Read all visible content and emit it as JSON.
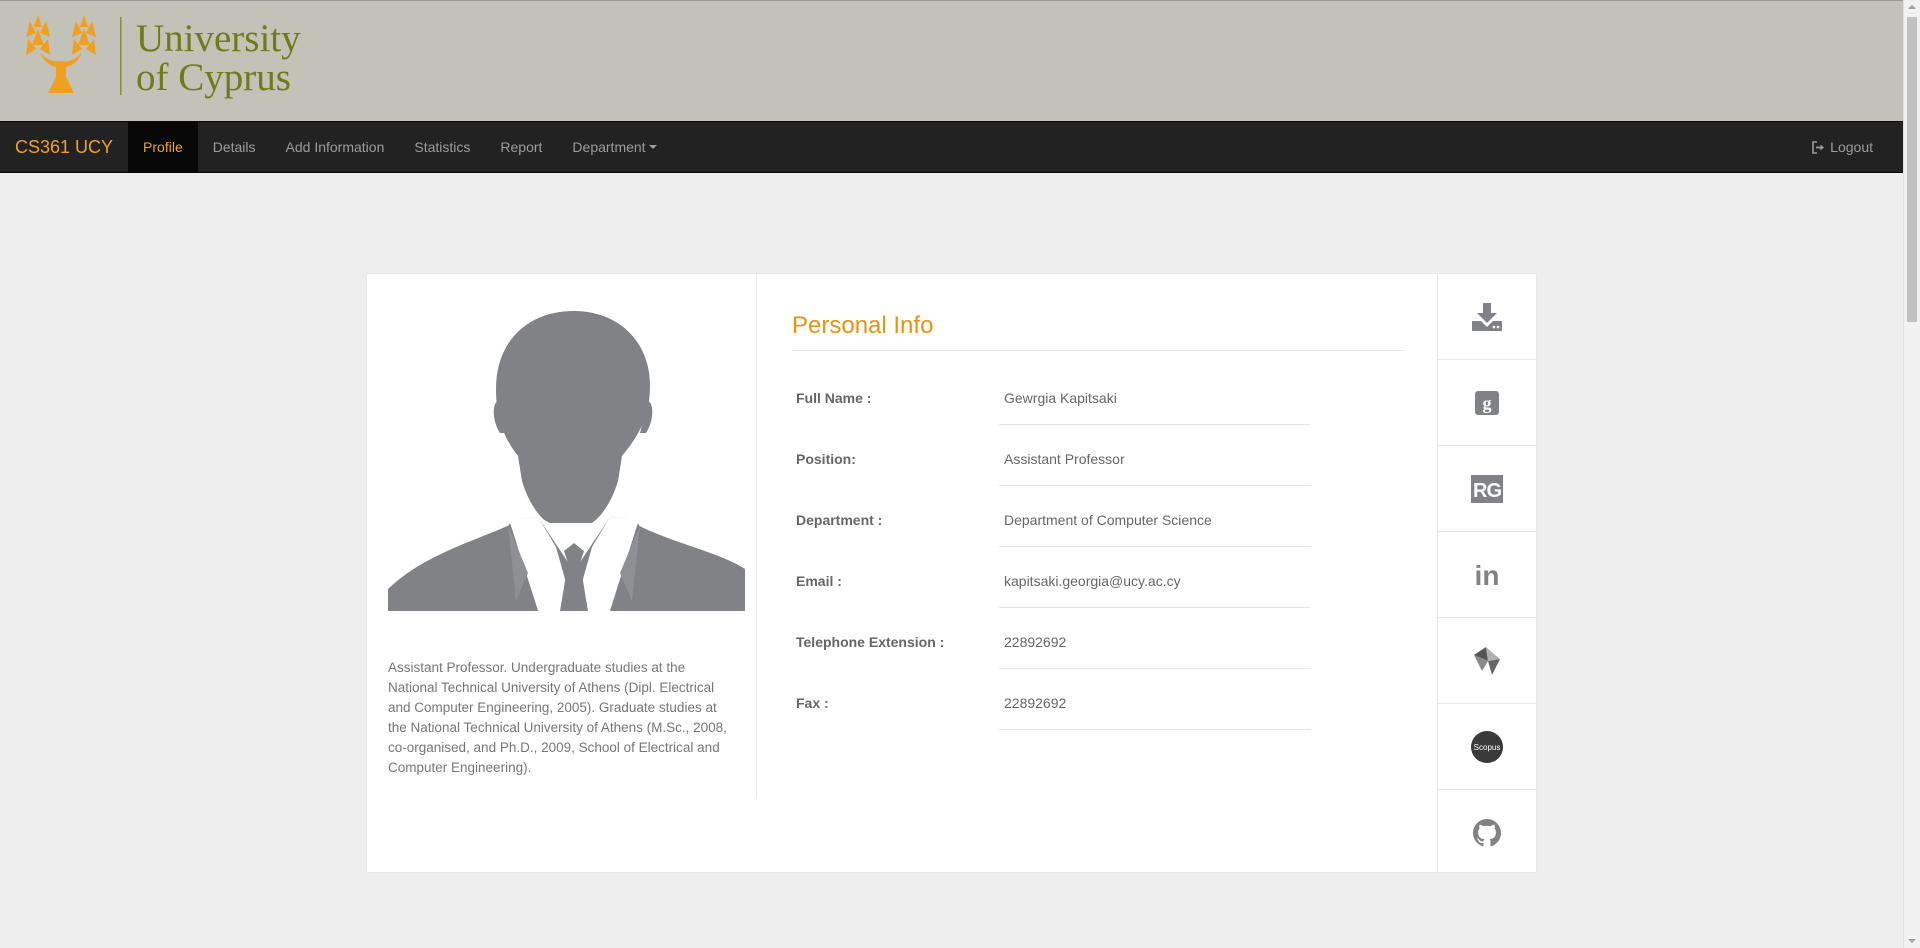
{
  "banner": {
    "logo_line1": "University",
    "logo_line2": "of Cyprus",
    "logo_icon": "tree-logo-icon"
  },
  "nav": {
    "brand": "CS361 UCY",
    "items": [
      {
        "label": "Profile",
        "active": true
      },
      {
        "label": "Details",
        "active": false
      },
      {
        "label": "Add Information",
        "active": false
      },
      {
        "label": "Statistics",
        "active": false
      },
      {
        "label": "Report",
        "active": false
      },
      {
        "label": "Department",
        "active": false
      }
    ],
    "logout": "Logout",
    "logout_icon": "sign-out-icon"
  },
  "profile": {
    "avatar_icon": "person-silhouette-icon",
    "bio": "Assistant Professor. Undergraduate studies at the National Technical University of Athens (Dipl. Electrical and Computer Engineering, 2005). Graduate studies at the National Technical University of Athens (M.Sc., 2008, co-organised, and Ph.D., 2009, School of Electrical and Computer Engineering).",
    "section_title": "Personal Info",
    "fields": [
      {
        "label": "Full Name :",
        "value": "Gewrgia Kapitsaki"
      },
      {
        "label": "Position:",
        "value": "Assistant Professor"
      },
      {
        "label": "Department :",
        "value": "Department of Computer Science"
      },
      {
        "label": "Email :",
        "value": "kapitsaki.georgia@ucy.ac.cy"
      },
      {
        "label": "Telephone Extension :",
        "value": "22892692"
      },
      {
        "label": "Fax :",
        "value": "22892692"
      }
    ]
  },
  "side_buttons": [
    {
      "icon": "download-icon"
    },
    {
      "icon": "google-scholar-icon"
    },
    {
      "icon": "researchgate-icon",
      "text": "RG"
    },
    {
      "icon": "linkedin-icon",
      "text": "in"
    },
    {
      "icon": "dblp-icon"
    },
    {
      "icon": "scopus-icon",
      "text": "Scopus"
    },
    {
      "icon": "github-icon"
    }
  ],
  "colors": {
    "accent": "#f0a030",
    "banner_bg": "#c3c2b8",
    "navbar_bg": "#222222",
    "logo_text": "#6e7b19",
    "title": "#e8930e",
    "icon_gray": "#808285"
  }
}
